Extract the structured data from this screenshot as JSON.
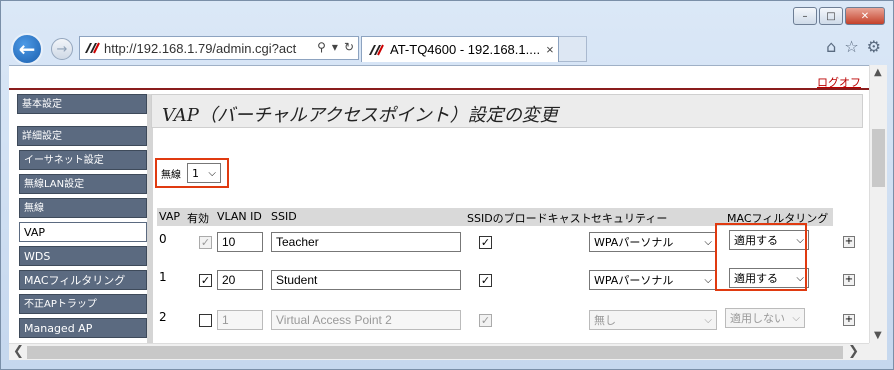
{
  "browser": {
    "url": "http://192.168.1.79/admin.cgi?act",
    "tab_title": "AT-TQ4600 - 192.168.1....",
    "window_buttons": [
      "–",
      "□",
      "✕"
    ]
  },
  "header": {
    "logoff_label": "ログオフ"
  },
  "sidebar": {
    "items": [
      {
        "label": "基本設定"
      },
      {
        "label": "詳細設定"
      },
      {
        "label": "イーサネット設定"
      },
      {
        "label": "無線LAN設定"
      },
      {
        "label": "無線"
      },
      {
        "label": "VAP"
      },
      {
        "label": "WDS"
      },
      {
        "label": "MACフィルタリング"
      },
      {
        "label": "不正APトラップ"
      },
      {
        "label": "Managed AP"
      }
    ]
  },
  "main": {
    "title": "VAP（バーチャルアクセスポイント）設定の変更",
    "radio_label": "無線",
    "radio_value": "1",
    "columns": {
      "vap": "VAP",
      "enabled": "有効",
      "vlan": "VLAN ID",
      "ssid": "SSID",
      "broadcast": "SSIDのブロードキャスト",
      "security": "セキュリティー",
      "mac": "MACフィルタリング"
    },
    "rows": [
      {
        "vap": "0",
        "enabled": "✓",
        "vlan": "10",
        "ssid": "Teacher",
        "broadcast": "✓",
        "security": "WPAパーソナル",
        "mac": "適用する"
      },
      {
        "vap": "1",
        "enabled": "✓",
        "vlan": "20",
        "ssid": "Student",
        "broadcast": "✓",
        "security": "WPAパーソナル",
        "mac": "適用する"
      },
      {
        "vap": "2",
        "enabled": "",
        "vlan": "1",
        "ssid": "Virtual Access Point 2",
        "broadcast": "✓",
        "security": "無し",
        "mac": "適用しない"
      }
    ],
    "expand_label": "+"
  }
}
